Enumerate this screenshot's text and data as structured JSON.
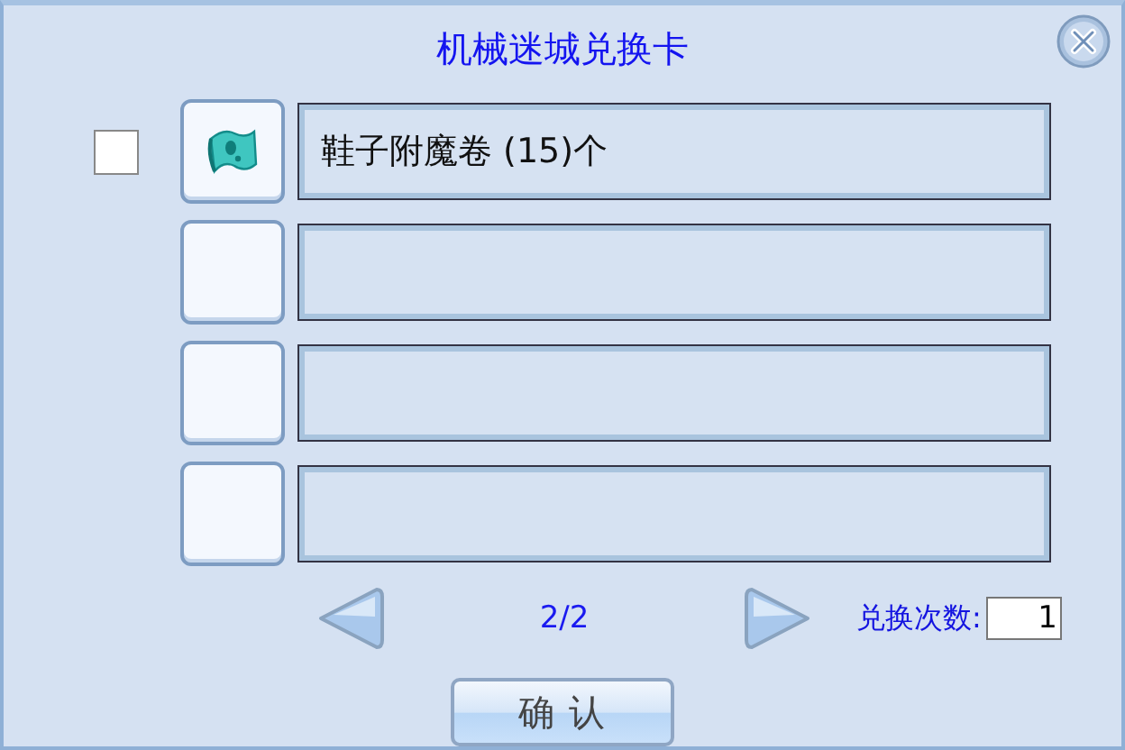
{
  "window": {
    "title": "机械迷城兑换卡"
  },
  "rows": [
    {
      "kind": "item",
      "checked": false,
      "label": "鞋子附魔卷 (15)个"
    },
    {
      "kind": "empty"
    },
    {
      "kind": "empty"
    },
    {
      "kind": "empty"
    }
  ],
  "pager": {
    "page": "2/2"
  },
  "count": {
    "label": "兑换次数:",
    "value": "1"
  },
  "buttons": [
    "确 认"
  ]
}
